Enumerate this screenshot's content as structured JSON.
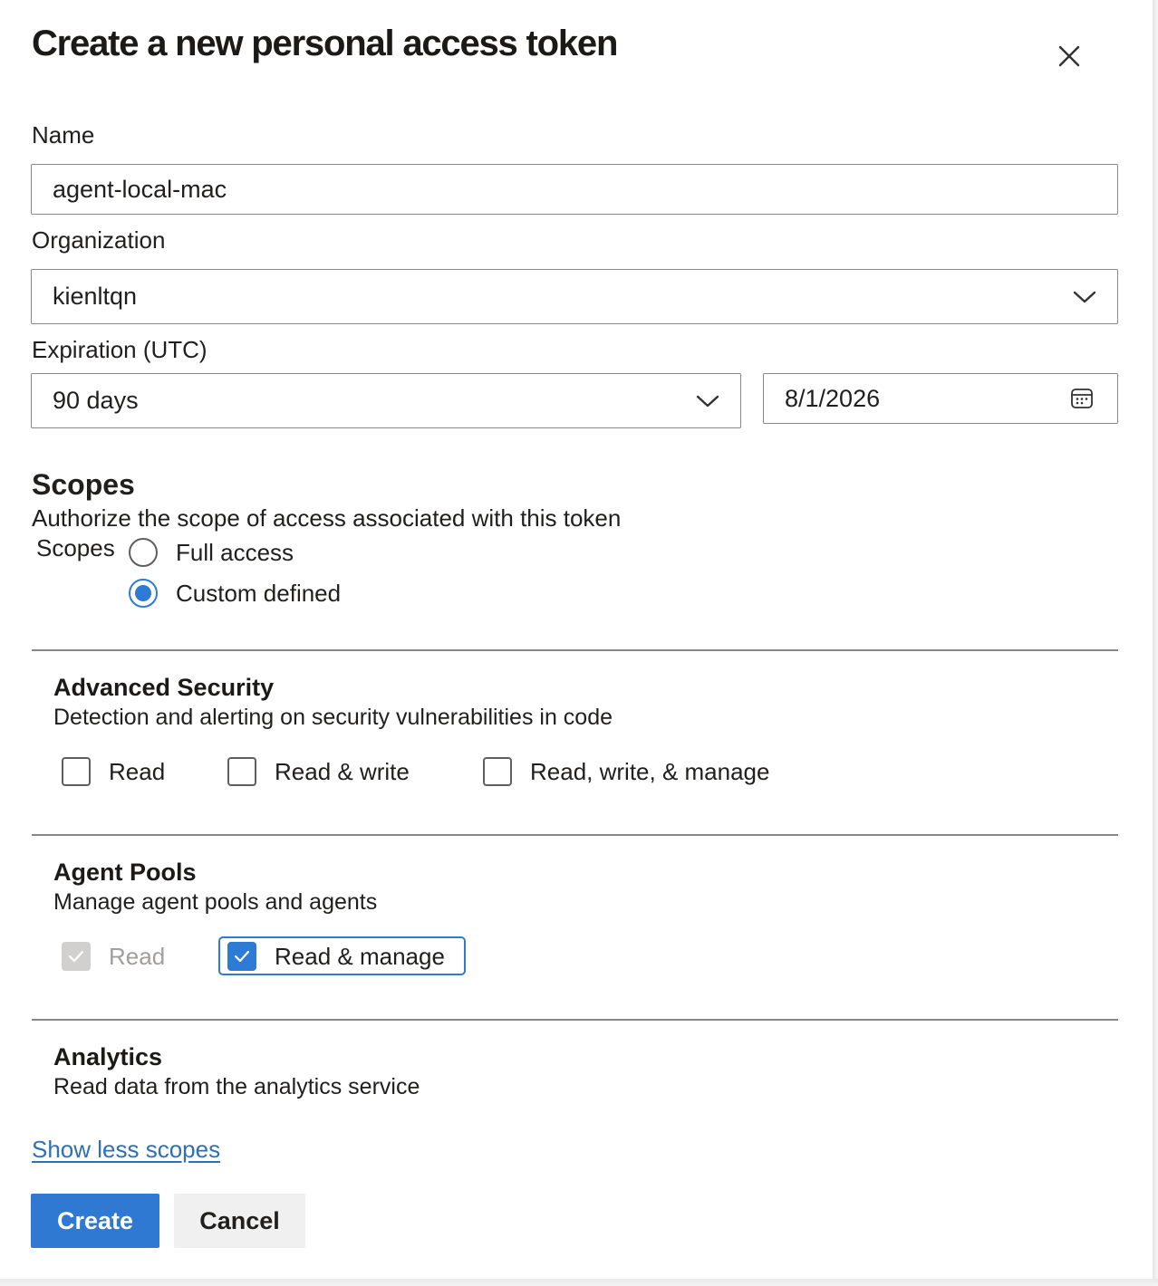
{
  "dialog": {
    "title": "Create a new personal access token",
    "close_icon": "close-icon"
  },
  "form": {
    "name": {
      "label": "Name",
      "value": "agent-local-mac"
    },
    "organization": {
      "label": "Organization",
      "value": "kienltqn",
      "icon": "chevron-down-icon"
    },
    "expiration": {
      "label": "Expiration (UTC)",
      "duration": "90 days",
      "date": "8/1/2026",
      "duration_icon": "chevron-down-icon",
      "date_icon": "calendar-icon"
    }
  },
  "scopes": {
    "heading": "Scopes",
    "description": "Authorize the scope of access associated with this token",
    "group_label": "Scopes",
    "options": [
      {
        "label": "Full access",
        "selected": false
      },
      {
        "label": "Custom defined",
        "selected": true
      }
    ]
  },
  "sections": [
    {
      "title": "Advanced Security",
      "description": "Detection and alerting on security vulnerabilities in code",
      "options": [
        {
          "label": "Read",
          "checked": false
        },
        {
          "label": "Read & write",
          "checked": false
        },
        {
          "label": "Read, write, & manage",
          "checked": false
        }
      ]
    },
    {
      "title": "Agent Pools",
      "description": "Manage agent pools and agents",
      "options": [
        {
          "label": "Read",
          "checked": true,
          "disabled": true
        },
        {
          "label": "Read & manage",
          "checked": true,
          "focused": true
        }
      ]
    },
    {
      "title": "Analytics",
      "description": "Read data from the analytics service"
    }
  ],
  "show_less_link": "Show less scopes",
  "buttons": {
    "create": "Create",
    "cancel": "Cancel"
  },
  "colors": {
    "accent": "#2f79d3",
    "link": "#2f6fb4",
    "border": "#8a8886"
  }
}
